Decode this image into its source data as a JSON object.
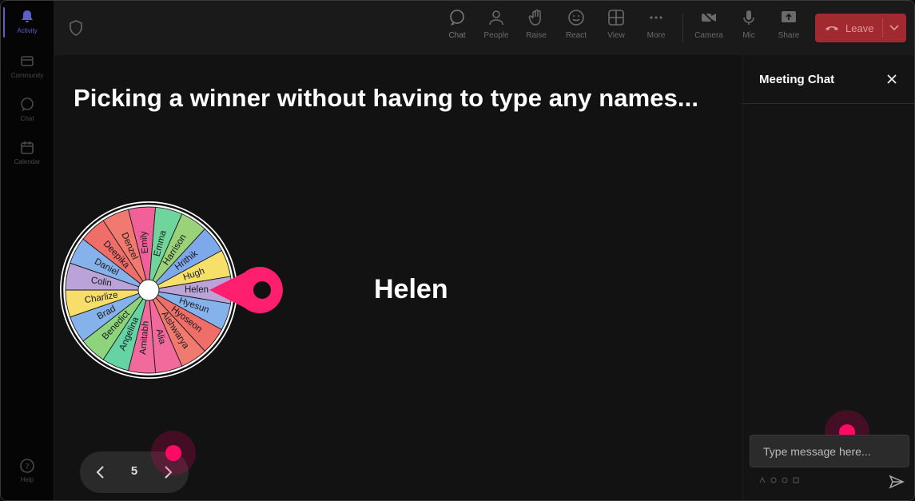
{
  "rail": {
    "items": [
      {
        "label": "Activity",
        "icon": "bell-icon"
      },
      {
        "label": "Community",
        "icon": "community-icon"
      },
      {
        "label": "Chat",
        "icon": "chat-icon"
      },
      {
        "label": "Calendar",
        "icon": "calendar-icon"
      }
    ],
    "help_label": "Help"
  },
  "toolbar": {
    "chat": "Chat",
    "people": "People",
    "raise": "Raise",
    "react": "React",
    "view": "View",
    "more": "More",
    "camera": "Camera",
    "mic": "Mic",
    "share": "Share",
    "leave": "Leave"
  },
  "stage": {
    "title": "Picking a winner without having to type any names...",
    "winner": "Helen",
    "wheel_names": [
      "Emily",
      "Emma",
      "Harrison",
      "Hrithik",
      "Hugh",
      "Helen",
      "Hyesun",
      "Hyoseon",
      "Aishwarya",
      "Alia",
      "Amitabh",
      "Angelina",
      "Benedict",
      "Brad",
      "Charlize",
      "Colin",
      "Daniel",
      "Deepika",
      "Denzel"
    ],
    "wheel_colors": [
      "#f2609a",
      "#6ed69c",
      "#9ad27a",
      "#7ea8ec",
      "#f7e06a",
      "#b9a3d8",
      "#86b2ec",
      "#ef6e6a",
      "#f07a70",
      "#f26a9c",
      "#f26a9c",
      "#64d4a4",
      "#8ed47c",
      "#86b2ec",
      "#f7de6a",
      "#b9a3d8",
      "#86b2ec",
      "#ef6e6a",
      "#f07a70"
    ],
    "pointer_color": "#ff1f6e",
    "page": "5"
  },
  "chat": {
    "title": "Meeting Chat",
    "placeholder": "Type message here..."
  },
  "colors": {
    "accent": "#5b5fc7",
    "leave": "#a02a30",
    "cursor": "#ff0a64"
  }
}
